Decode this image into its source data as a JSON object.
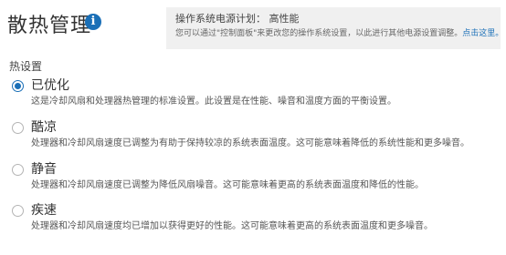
{
  "page": {
    "title": "散热管理",
    "info_icon": "info-icon"
  },
  "power_plan": {
    "title": "操作系统电源计划： 高性能",
    "description": "您可以通过\"控制面板\"来更改您的操作系统设置，以此进行其他电源设置调整。",
    "link_label": "点击这里。"
  },
  "thermal_settings": {
    "heading": "热设置",
    "options": [
      {
        "label": "已优化",
        "description": "这是冷却风扇和处理器热管理的标准设置。此设置是在性能、噪音和温度方面的平衡设置。",
        "selected": true
      },
      {
        "label": "酷凉",
        "description": "处理器和冷却风扇速度已调整为有助于保持较凉的系统表面温度。这可能意味着降低的系统性能和更多噪音。",
        "selected": false
      },
      {
        "label": "静音",
        "description": "处理器和冷却风扇速度已调整为降低风扇噪音。这可能意味着更高的系统表面温度和降低的性能。",
        "selected": false
      },
      {
        "label": "疾速",
        "description": "处理器和冷却风扇速度均已增加以获得更好的性能。这可能意味着更高的系统表面温度和更多噪音。",
        "selected": false
      }
    ]
  },
  "colors": {
    "accent": "#1a6fb7",
    "plan_box_bg": "#f0f0f0",
    "text": "#333333"
  }
}
